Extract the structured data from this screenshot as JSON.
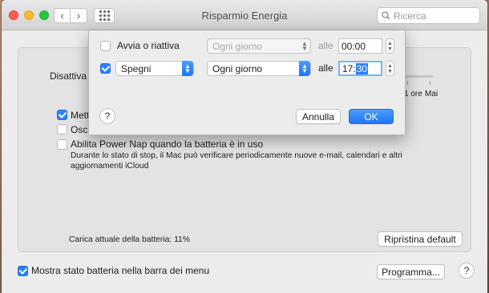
{
  "window": {
    "title": "Risparmio Energia",
    "search_placeholder": "Ricerca"
  },
  "background_panel": {
    "sleep_label_partial": "Disattiva",
    "slider_tick_labels": [
      "1 ore",
      "Mai"
    ],
    "option1_partial": "Mett",
    "option1_checked": true,
    "option2_partial": "Oscu",
    "option2_checked": false,
    "power_nap_label": "Abilita Power Nap quando la batteria è in uso",
    "power_nap_checked": false,
    "power_nap_desc_line1": "Durante lo stato di stop, il Mac può verificare periodicamente nuove e-mail, calendari e altri",
    "power_nap_desc_line2": "aggiornamenti iCloud",
    "battery_charge": "Carica attuale della batteria: 11%",
    "restore_default_button": "Ripristina default"
  },
  "footer": {
    "show_battery_label": "Mostra stato batteria nella barra dei menu",
    "show_battery_checked": true,
    "schedule_button": "Programma...",
    "help_label": "?"
  },
  "sheet": {
    "row1": {
      "checked": false,
      "label": "Avvia o riattiva",
      "frequency": "Ogni giorno",
      "at_label": "alle",
      "time": "00:00"
    },
    "row2": {
      "checked": true,
      "action": "Spegni",
      "frequency": "Ogni giorno",
      "at_label": "alle",
      "time_hours": "17:",
      "time_minutes": "30"
    },
    "help_label": "?",
    "cancel_button": "Annulla",
    "ok_button": "OK"
  },
  "colors": {
    "accent": "#2c83f5",
    "window_bg": "#ececec",
    "close": "#fd5f57",
    "minimize": "#fdbc2e",
    "maximize": "#28c940"
  }
}
